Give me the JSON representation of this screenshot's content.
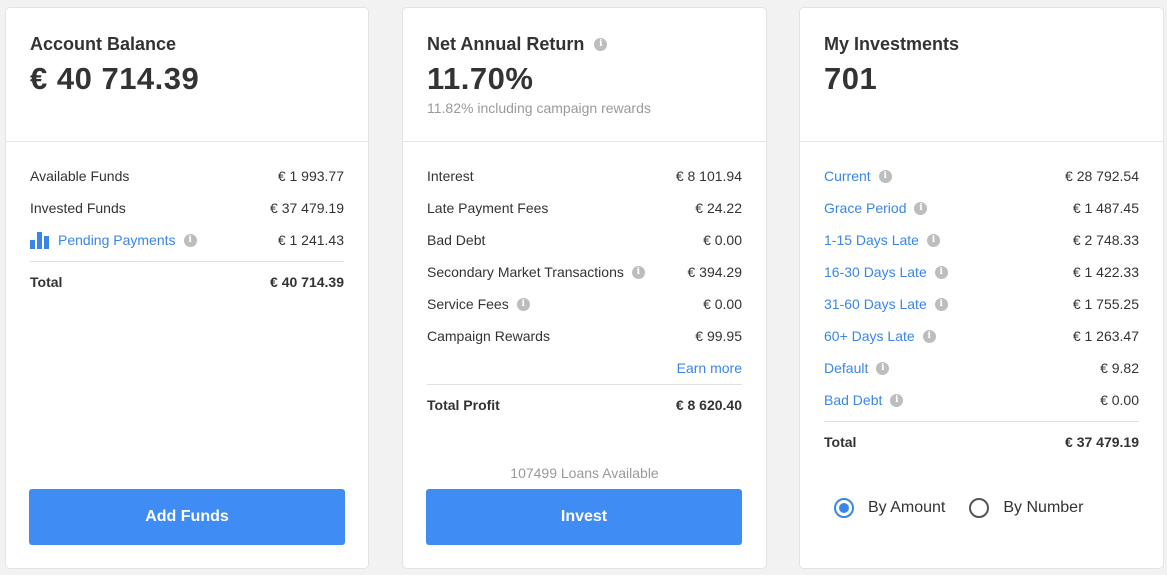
{
  "account_balance": {
    "title": "Account Balance",
    "value": "€ 40 714.39",
    "rows": [
      {
        "label": "Available Funds",
        "value": "€ 1 993.77"
      },
      {
        "label": "Invested Funds",
        "value": "€ 37 479.19"
      },
      {
        "label": "Pending Payments",
        "value": "€ 1 241.43"
      }
    ],
    "total_label": "Total",
    "total_value": "€ 40 714.39",
    "button_label": "Add Funds"
  },
  "net_annual_return": {
    "title": "Net Annual Return",
    "value": "11.70%",
    "subtitle": "11.82% including campaign rewards",
    "rows": [
      {
        "label": "Interest",
        "value": "€ 8 101.94"
      },
      {
        "label": "Late Payment Fees",
        "value": "€ 24.22"
      },
      {
        "label": "Bad Debt",
        "value": "€ 0.00"
      },
      {
        "label": "Secondary Market Transactions",
        "value": "€ 394.29"
      },
      {
        "label": "Service Fees",
        "value": "€ 0.00"
      },
      {
        "label": "Campaign Rewards",
        "value": "€ 99.95"
      }
    ],
    "earn_more": "Earn more",
    "total_label": "Total Profit",
    "total_value": "€ 8 620.40",
    "loans_available": "107499 Loans Available",
    "button_label": "Invest"
  },
  "my_investments": {
    "title": "My Investments",
    "value": "701",
    "rows": [
      {
        "label": "Current",
        "value": "€ 28 792.54"
      },
      {
        "label": "Grace Period",
        "value": "€ 1 487.45"
      },
      {
        "label": "1-15 Days Late",
        "value": "€ 2 748.33"
      },
      {
        "label": "16-30 Days Late",
        "value": "€ 1 422.33"
      },
      {
        "label": "31-60 Days Late",
        "value": "€ 1 755.25"
      },
      {
        "label": "60+ Days Late",
        "value": "€ 1 263.47"
      },
      {
        "label": "Default",
        "value": "€ 9.82"
      },
      {
        "label": "Bad Debt",
        "value": "€ 0.00"
      }
    ],
    "total_label": "Total",
    "total_value": "€ 37 479.19",
    "radio_options": [
      "By Amount",
      "By Number"
    ],
    "selected_option": "By Amount"
  },
  "icons": {
    "info": "info-icon",
    "pending": "bar-chart-icon"
  },
  "colors": {
    "accent": "#3e8cf4",
    "link": "#3a86e8",
    "muted": "#9a9a9a"
  }
}
